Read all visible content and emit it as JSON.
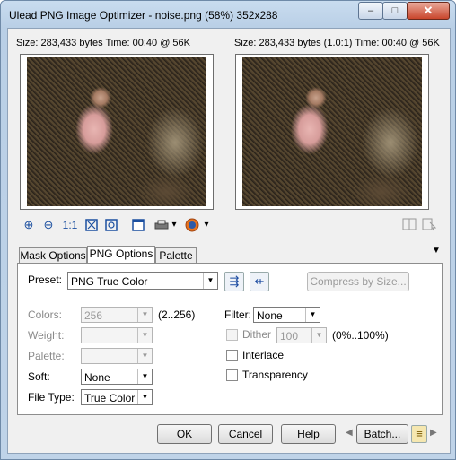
{
  "window": {
    "title": "Ulead PNG Image Optimizer - noise.png (58%) 352x288",
    "minimize_glyph": "–",
    "maximize_glyph": "□",
    "close_glyph": "✕"
  },
  "preview": {
    "left_info": "Size: 283,433 bytes Time: 00:40 @ 56K",
    "right_info": "Size: 283,433 bytes (1.0:1) Time: 00:40 @ 56K"
  },
  "toolbar": {
    "zoom_in_glyph": "⊕",
    "zoom_out_glyph": "⊖",
    "actual_size_label": "1:1",
    "menu_arrow_glyph": "▾"
  },
  "tabs": [
    "Mask Options",
    "PNG Options",
    "Palette"
  ],
  "tabs_menu_glyph": "▼",
  "png_options": {
    "preset_label": "Preset:",
    "preset_value": "PNG True Color",
    "compress_button": "Compress by Size...",
    "colors_label": "Colors:",
    "colors_value": "256",
    "colors_range": "(2..256)",
    "weight_label": "Weight:",
    "palette_label": "Palette:",
    "soft_label": "Soft:",
    "soft_value": "None",
    "file_type_label": "File Type:",
    "file_type_value": "True Color",
    "filter_label": "Filter:",
    "filter_value": "None",
    "dither_label": "Dither",
    "dither_value": "100",
    "dither_range": "(0%..100%)",
    "interlace_label": "Interlace",
    "transparency_label": "Transparency"
  },
  "buttons": {
    "ok": "OK",
    "cancel": "Cancel",
    "help": "Help",
    "batch": "Batch..."
  },
  "colors": {
    "accent": "#1b4fa0",
    "titlebar": "#bfd3e8"
  }
}
